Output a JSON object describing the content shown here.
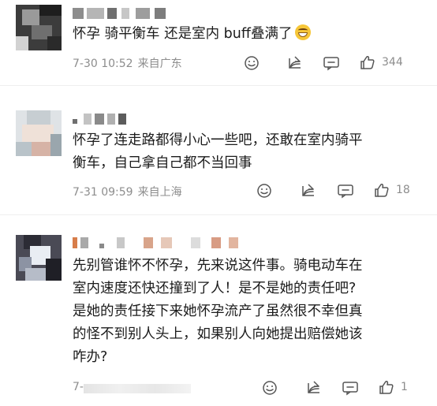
{
  "comments": [
    {
      "text": "怀孕 骑平衡车 还是室内 buff叠满了",
      "date_time": "7-30 10:52",
      "location": "来自广东",
      "likes": "344"
    },
    {
      "text_lines": [
        "怀孕了连走路都得小心一些吧，还敢在室内骑平",
        "衡车，自己拿自己都不当回事"
      ],
      "date_time": "7-31 09:59",
      "location": "来自上海",
      "likes": "18"
    },
    {
      "text_lines": [
        "先别管谁怀不怀孕，先来说这件事。骑电动车在",
        "室内速度还快还撞到了人！是不是她的责任吧?",
        "是她的责任接下来她怀孕流产了虽然很不幸但真",
        "的怪不到别人头上，如果别人向她提出赔偿她该",
        "咋办?"
      ],
      "date_time": "7-",
      "likes": "1"
    }
  ],
  "icons": {
    "emoji": "grinning-sweat-emoji",
    "reaction": "smiley-face-icon",
    "share": "share-icon",
    "comment": "comment-icon",
    "like": "thumbs-up-icon"
  },
  "colors": {
    "text": "#1b1b1b",
    "meta": "#8d8d8d",
    "icon": "#555555"
  }
}
